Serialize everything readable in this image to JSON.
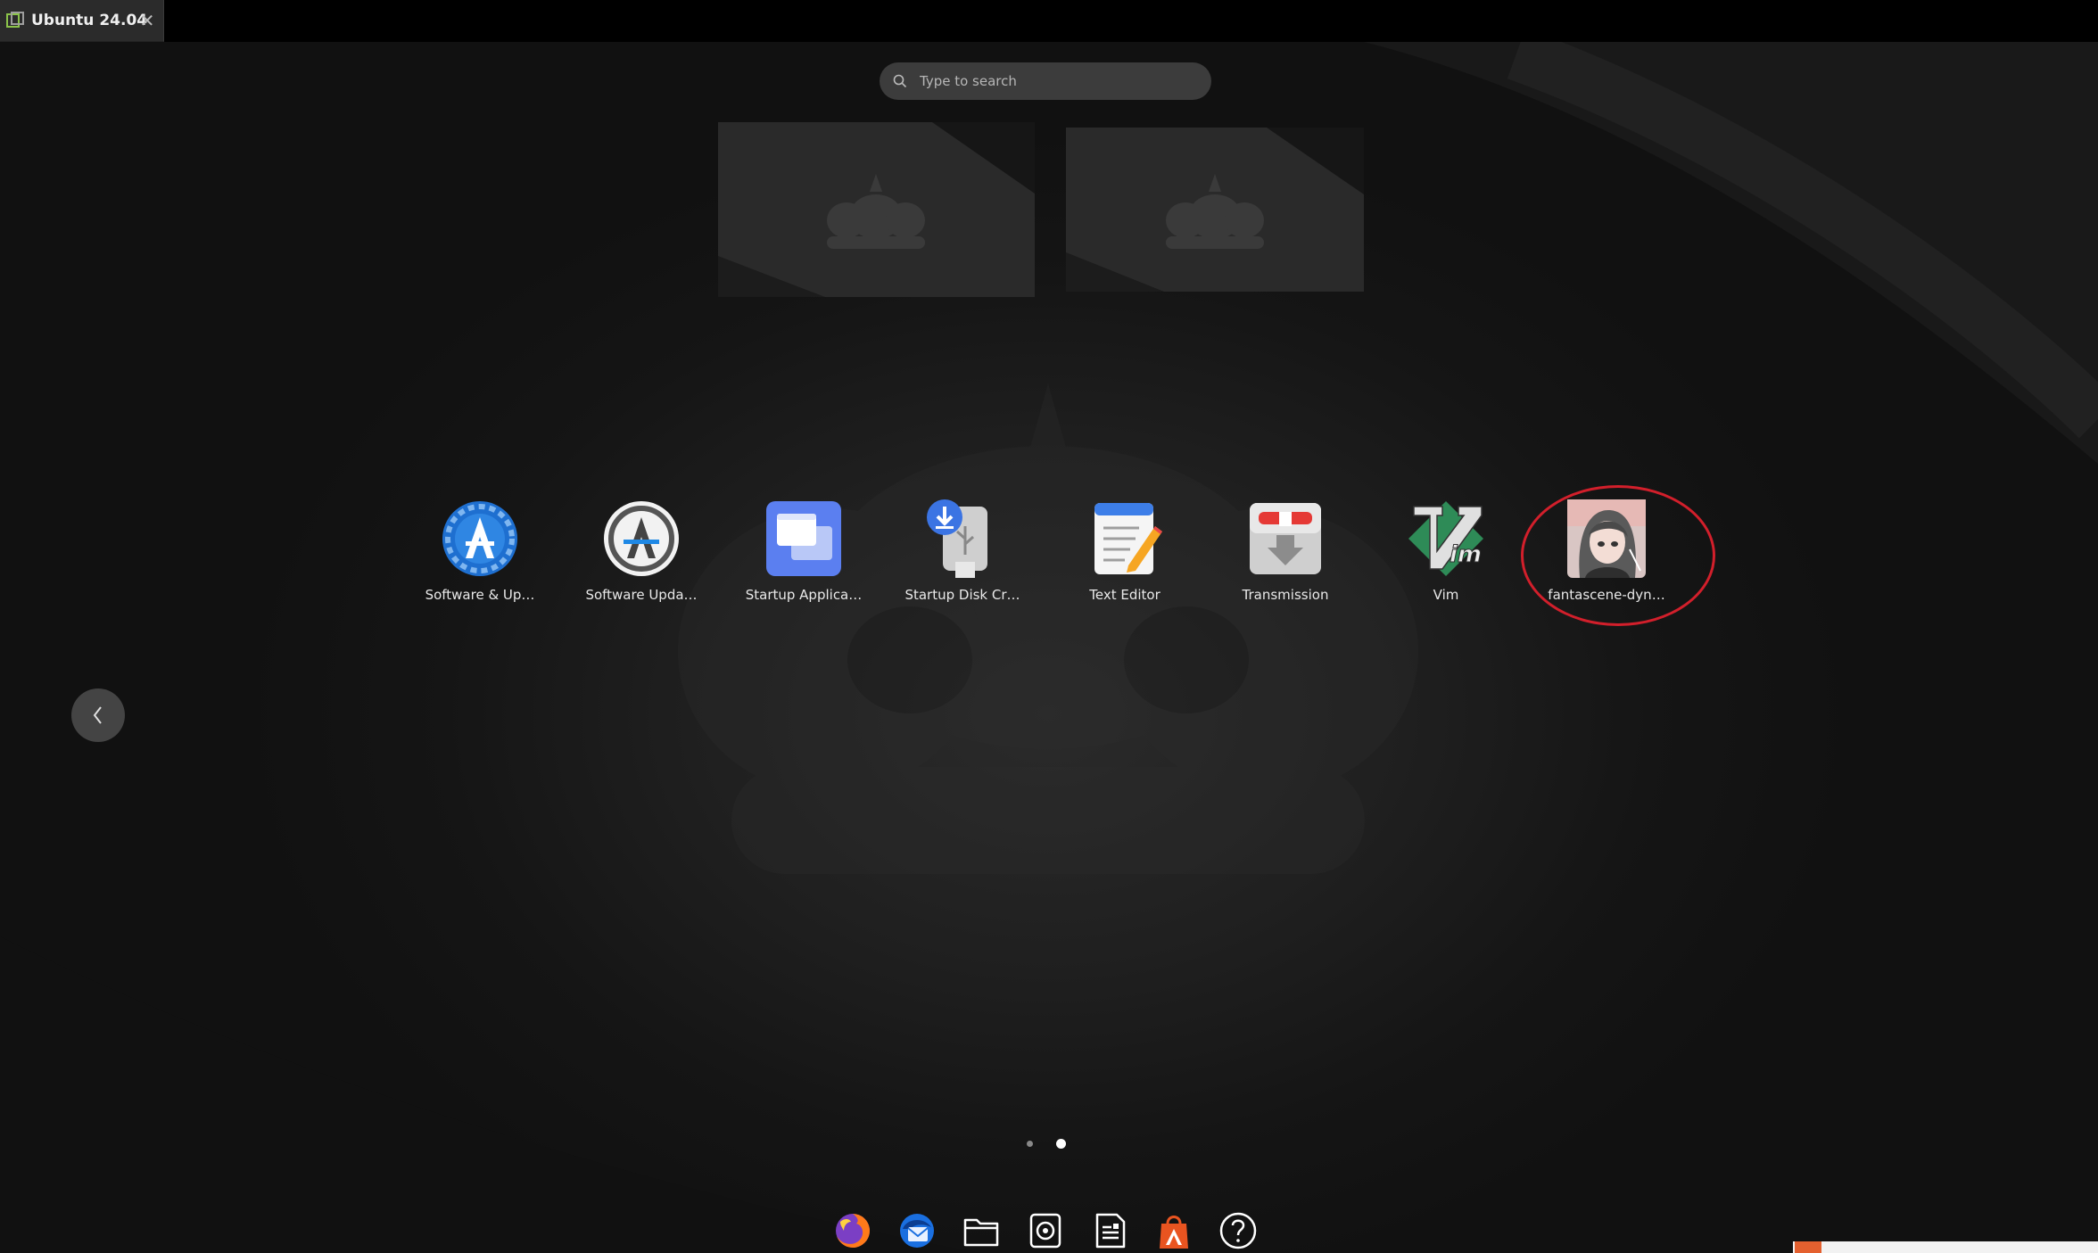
{
  "window": {
    "tab_title": "Ubuntu 24.04",
    "close_icon": "close-icon"
  },
  "search": {
    "placeholder": "Type to search",
    "icon": "search-icon"
  },
  "workspaces": [
    {
      "name": "workspace-1"
    },
    {
      "name": "workspace-2"
    }
  ],
  "apps": [
    {
      "label": "Software & Up…",
      "icon": "software-properties-icon"
    },
    {
      "label": "Software Upda…",
      "icon": "software-updater-icon"
    },
    {
      "label": "Startup Applica…",
      "icon": "startup-applications-icon"
    },
    {
      "label": "Startup Disk Cr…",
      "icon": "usb-creator-icon"
    },
    {
      "label": "Text Editor",
      "icon": "text-editor-icon"
    },
    {
      "label": "Transmission",
      "icon": "transmission-icon"
    },
    {
      "label": "Vim",
      "icon": "vim-icon"
    },
    {
      "label": "fantascene-dyn…",
      "icon": "fantascene-icon",
      "highlighted": true
    }
  ],
  "navigation": {
    "prev_icon": "chevron-left-icon"
  },
  "pagination": {
    "pages": 2,
    "current_page": 2
  },
  "dock": [
    {
      "name": "firefox",
      "icon": "firefox-icon"
    },
    {
      "name": "thunderbird",
      "icon": "thunderbird-icon"
    },
    {
      "name": "files",
      "icon": "folder-icon"
    },
    {
      "name": "rhythmbox",
      "icon": "music-player-icon"
    },
    {
      "name": "writer",
      "icon": "document-icon"
    },
    {
      "name": "app-center",
      "icon": "app-center-icon"
    },
    {
      "name": "help",
      "icon": "help-icon"
    }
  ],
  "colors": {
    "highlight_ring": "#d21f2b",
    "accent_orange": "#e95420",
    "background": "#141414"
  }
}
